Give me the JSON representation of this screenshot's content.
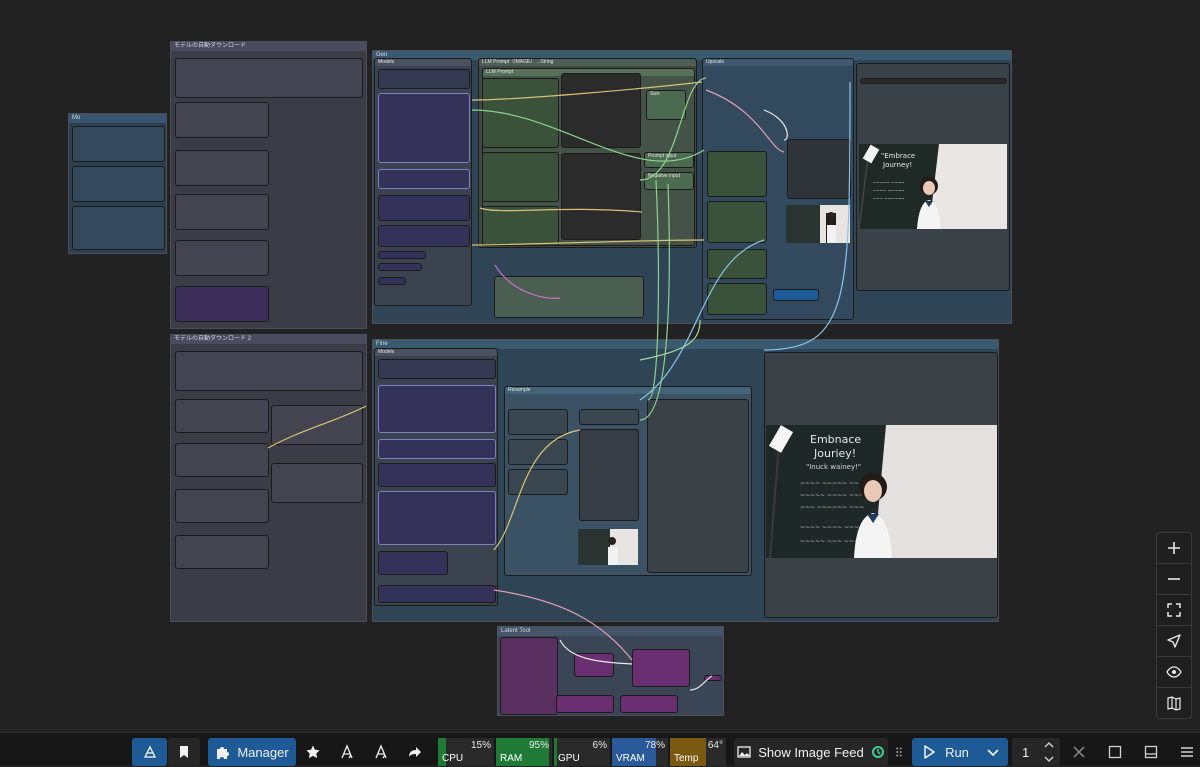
{
  "canvas": {
    "groups": {
      "g_left_small": {
        "title": "Mo"
      },
      "g_model_dl": {
        "title": "モデルの自動ダウンロード"
      },
      "g_model_dl2": {
        "title": "モデルの自動ダウンロード 2"
      },
      "g_gen": {
        "title": "Gen"
      },
      "g_fine": {
        "title": "Fine"
      },
      "g_latent": {
        "title": "Latent Tool"
      }
    },
    "nodes": {
      "models_top": "Models",
      "llm_prompt": "LLM Prompt（IMAGE）→String",
      "llm_prompt_inner": "LLM Prompt",
      "size": "Size",
      "prompt_input": "Prompt input",
      "negative_input": "Negative input",
      "upscale": "Upscale",
      "models_bottom": "Models",
      "resample": "Resample"
    }
  },
  "zoom_controls": [
    "zoom-in",
    "zoom-out",
    "fit-view",
    "locate",
    "toggle-visibility",
    "minimap"
  ],
  "toolbar": {
    "manager_label": "Manager",
    "meters": [
      {
        "name": "CPU",
        "value": "15%",
        "percent": 15,
        "color": "#1f7a35"
      },
      {
        "name": "RAM",
        "value": "95%",
        "percent": 95,
        "color": "#1f7a35"
      },
      {
        "name": "GPU",
        "value": "6%",
        "percent": 6,
        "color": "#1f7a35"
      },
      {
        "name": "VRAM",
        "value": "78%",
        "percent": 78,
        "color": "#2a5a9a"
      },
      {
        "name": "Temp",
        "value": "64°",
        "percent": 64,
        "color": "#7a5a10"
      }
    ],
    "image_feed_label": "Show Image Feed",
    "run_label": "Run",
    "batch_count": "1"
  },
  "colors": {
    "accent_blue": "#1e5a96",
    "bar_bg": "#171717",
    "canvas_bg": "#222222"
  }
}
